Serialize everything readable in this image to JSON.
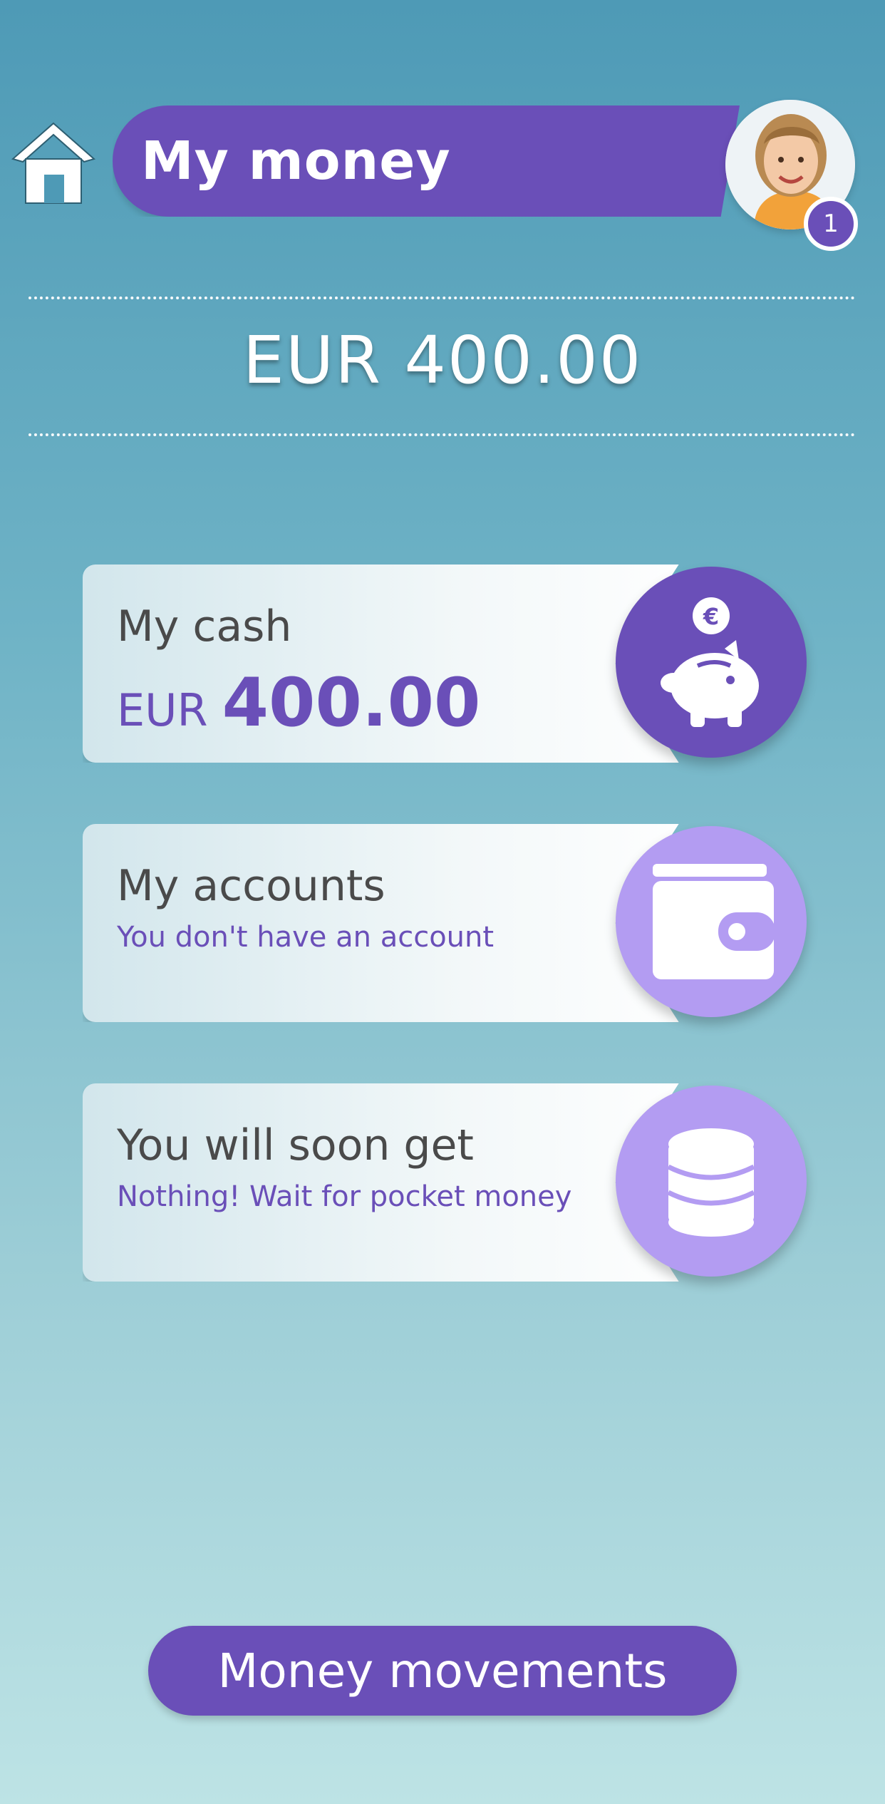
{
  "header": {
    "title": "My money",
    "notification_count": "1",
    "home_icon": "home-icon",
    "avatar_icon": "child-avatar"
  },
  "total": "EUR 400.00",
  "cards": [
    {
      "title": "My cash",
      "currency": "EUR",
      "amount": "400.00",
      "icon": "piggy-bank-icon",
      "coin_symbol": "€"
    },
    {
      "title": "My accounts",
      "subtitle": "You don't have an account",
      "icon": "wallet-icon"
    },
    {
      "title": "You will soon get",
      "subtitle": "Nothing! Wait for pocket money",
      "icon": "coins-stack-icon"
    }
  ],
  "bottom_button": "Money movements",
  "colors": {
    "accent": "#6a4fb8",
    "accent_light": "#b39cf2",
    "text_dark": "#4a4a4a"
  }
}
